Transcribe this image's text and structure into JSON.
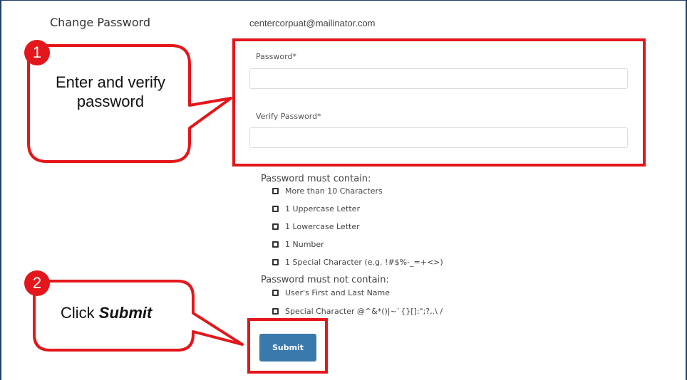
{
  "page": {
    "section_title": "Change Password",
    "email": "centercorpuat@mailinator.com"
  },
  "form": {
    "password_label": "Password*",
    "password_value": "",
    "verify_label": "Verify Password*",
    "verify_value": ""
  },
  "requirements": {
    "must_contain_heading": "Password must contain:",
    "must_contain": [
      "More than 10 Characters",
      "1 Uppercase Letter",
      "1 Lowercase Letter",
      "1 Number",
      "1 Special Character (e.g. !#$%-_=+<>)"
    ],
    "must_not_contain_heading": "Password must not contain:",
    "must_not_contain": [
      "User's First and Last Name",
      "Special Character @^&*()|~`{}[]:\";?,.\\ /"
    ]
  },
  "actions": {
    "submit_label": "Submit"
  },
  "callouts": [
    {
      "number": "1",
      "text": "Enter and verify password"
    },
    {
      "number": "2",
      "text_prefix": "Click ",
      "text_emphasis": "Submit"
    }
  ],
  "colors": {
    "highlight": "#e3171b",
    "button": "#3a79ac",
    "frame": "#1f3f6b"
  }
}
